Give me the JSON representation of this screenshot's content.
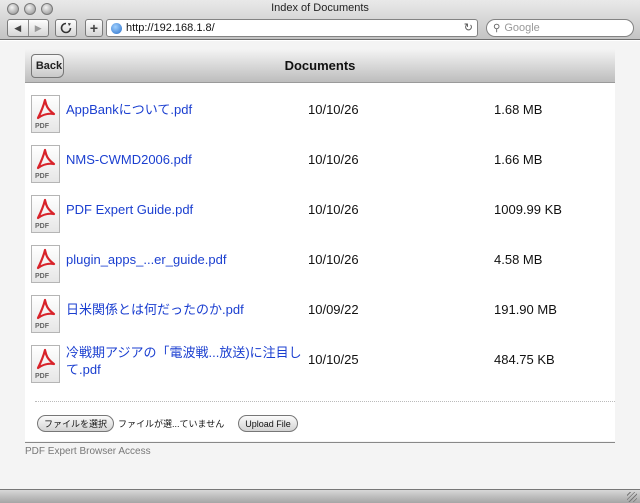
{
  "window": {
    "title": "Index of Documents"
  },
  "toolbar": {
    "back_glyph": "◀",
    "forward_glyph": "▶",
    "add_glyph": "+",
    "url": "http://192.168.1.8/",
    "reload_glyph": "↻",
    "search_placeholder": "Google"
  },
  "navbar": {
    "back_label": "Back",
    "title": "Documents"
  },
  "files": [
    {
      "name": "AppBankについて.pdf",
      "date": "10/10/26",
      "size": "1.68 MB"
    },
    {
      "name": "NMS-CWMD2006.pdf",
      "date": "10/10/26",
      "size": "1.66 MB"
    },
    {
      "name": "PDF Expert Guide.pdf",
      "date": "10/10/26",
      "size": "1009.99 KB"
    },
    {
      "name": "plugin_apps_...er_guide.pdf",
      "date": "10/10/26",
      "size": "4.58 MB"
    },
    {
      "name": "日米関係とは何だったのか.pdf",
      "date": "10/09/22",
      "size": "191.90 MB"
    },
    {
      "name": "冷戦期アジアの「電波戦...放送)に注目して.pdf",
      "date": "10/10/25",
      "size": "484.75 KB"
    }
  ],
  "file_icon_tag": "PDF",
  "upload": {
    "choose_label": "ファイルを選択",
    "no_file_text": "ファイルが選...ていません",
    "upload_label": "Upload File"
  },
  "footer": {
    "text": "PDF Expert Browser Access"
  },
  "colors": {
    "link": "#1b3fd0",
    "pdf_red": "#d8232a"
  }
}
